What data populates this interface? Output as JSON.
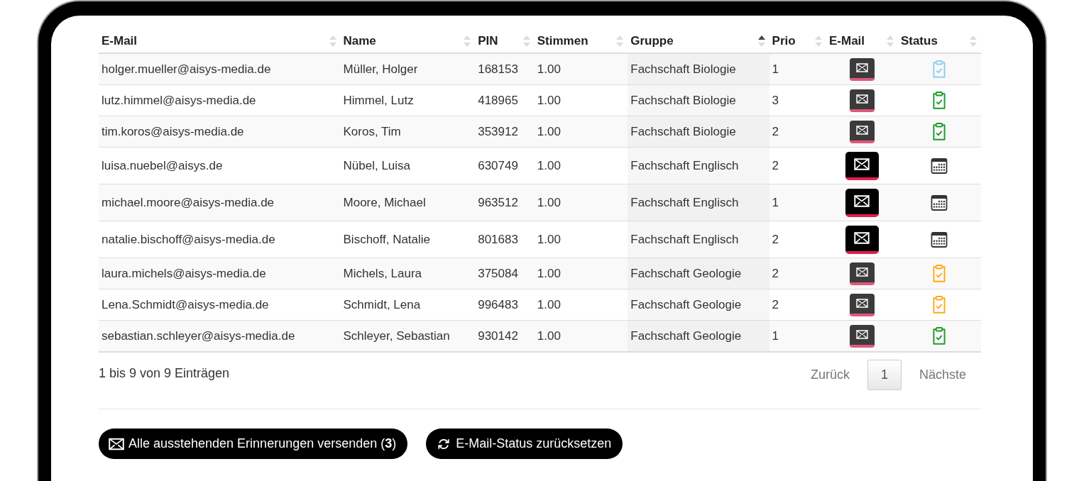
{
  "table": {
    "columns": [
      {
        "label": "E-Mail",
        "sorted": false
      },
      {
        "label": "Name",
        "sorted": false
      },
      {
        "label": "PIN",
        "sorted": false
      },
      {
        "label": "Stimmen",
        "sorted": false
      },
      {
        "label": "Gruppe",
        "sorted": true
      },
      {
        "label": "Prio",
        "sorted": false
      },
      {
        "label": "E-Mail",
        "sorted": false
      },
      {
        "label": "Status",
        "sorted": false
      }
    ],
    "rows": [
      {
        "email": "holger.mueller@aisys-media.de",
        "name": "Müller, Holger",
        "pin": "168153",
        "votes": "1.00",
        "group": "Fachschaft Biologie",
        "prio": "1",
        "pending": false,
        "status": {
          "kind": "clipboard",
          "color": "#8ecfee"
        }
      },
      {
        "email": "lutz.himmel@aisys-media.de",
        "name": "Himmel, Lutz",
        "pin": "418965",
        "votes": "1.00",
        "group": "Fachschaft Biologie",
        "prio": "3",
        "pending": false,
        "status": {
          "kind": "clipboard",
          "color": "#1e9a2a"
        }
      },
      {
        "email": "tim.koros@aisys-media.de",
        "name": "Koros, Tim",
        "pin": "353912",
        "votes": "1.00",
        "group": "Fachschaft Biologie",
        "prio": "2",
        "pending": false,
        "status": {
          "kind": "clipboard",
          "color": "#1e9a2a"
        }
      },
      {
        "email": "luisa.nuebel@aisys.de",
        "name": "Nübel, Luisa",
        "pin": "630749",
        "votes": "1.00",
        "group": "Fachschaft Englisch",
        "prio": "2",
        "pending": true,
        "status": {
          "kind": "calendar"
        }
      },
      {
        "email": "michael.moore@aisys-media.de",
        "name": "Moore, Michael",
        "pin": "963512",
        "votes": "1.00",
        "group": "Fachschaft Englisch",
        "prio": "1",
        "pending": true,
        "status": {
          "kind": "calendar"
        }
      },
      {
        "email": "natalie.bischoff@aisys-media.de",
        "name": "Bischoff, Natalie",
        "pin": "801683",
        "votes": "1.00",
        "group": "Fachschaft Englisch",
        "prio": "2",
        "pending": true,
        "status": {
          "kind": "calendar"
        }
      },
      {
        "email": "laura.michels@aisys-media.de",
        "name": "Michels, Laura",
        "pin": "375084",
        "votes": "1.00",
        "group": "Fachschaft Geologie",
        "prio": "2",
        "pending": false,
        "status": {
          "kind": "clipboard",
          "color": "#ffaa1a"
        }
      },
      {
        "email": "Lena.Schmidt@aisys-media.de",
        "name": "Schmidt, Lena",
        "pin": "996483",
        "votes": "1.00",
        "group": "Fachschaft Geologie",
        "prio": "2",
        "pending": false,
        "status": {
          "kind": "clipboard",
          "color": "#ffaa1a"
        }
      },
      {
        "email": "sebastian.schleyer@aisys-media.de",
        "name": "Schleyer, Sebastian",
        "pin": "930142",
        "votes": "1.00",
        "group": "Fachschaft Geologie",
        "prio": "1",
        "pending": false,
        "status": {
          "kind": "clipboard",
          "color": "#1e9a2a"
        }
      }
    ]
  },
  "info": "1 bis 9 von 9 Einträgen",
  "pagination": [
    {
      "label": "Zurück",
      "kind": "prev",
      "disabled": true
    },
    {
      "label": "1",
      "kind": "page",
      "selected": true
    },
    {
      "label": "Nächste",
      "kind": "next",
      "disabled": true
    }
  ],
  "actions": [
    {
      "label": "Alle ausstehenden Erinnerungen versenden (**3**)",
      "kind": "send"
    },
    {
      "label": "E-Mail-Status zurücksetzen",
      "kind": "reset"
    }
  ]
}
